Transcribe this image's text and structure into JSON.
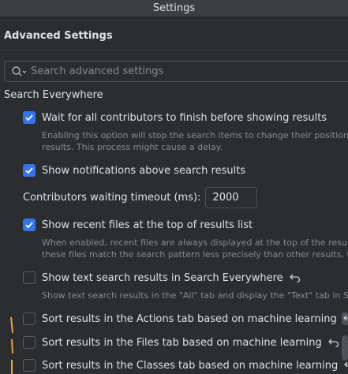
{
  "window": {
    "title": "Settings"
  },
  "header": {
    "title": "Advanced Settings"
  },
  "search": {
    "placeholder": "Search advanced settings"
  },
  "section": {
    "title": "Search Everywhere"
  },
  "options": [
    {
      "label": "Wait for all contributors to finish before showing results",
      "checked": true,
      "desc1": "Enabling this option will stop the search items to change their position",
      "desc2": "results. This process might cause a delay."
    },
    {
      "label": "Show notifications above search results",
      "checked": true
    },
    {
      "label": "Show recent files at the top of results list",
      "checked": true,
      "desc1": "When enabled, recent files are always displayed at the top of the resu",
      "desc2": "these files match the search pattern less precisely than other results, t"
    },
    {
      "label": "Show text search results in Search Everywhere",
      "checked": false,
      "desc1": "Show text search results in the \"All\" tab and display the \"Text\" tab in S"
    },
    {
      "label": "Sort results in the Actions tab based on machine learning",
      "checked": false
    },
    {
      "label": "Sort results in the Files tab based on machine learning",
      "checked": false
    },
    {
      "label": "Sort results in the Classes tab based on machine learning",
      "checked": false
    }
  ],
  "timeout": {
    "label": "Contributors waiting timeout (ms):",
    "value": "2000"
  },
  "colors": {
    "accent": "#3574f0",
    "background": "#2b2d30",
    "marker": "#e8a33c"
  }
}
